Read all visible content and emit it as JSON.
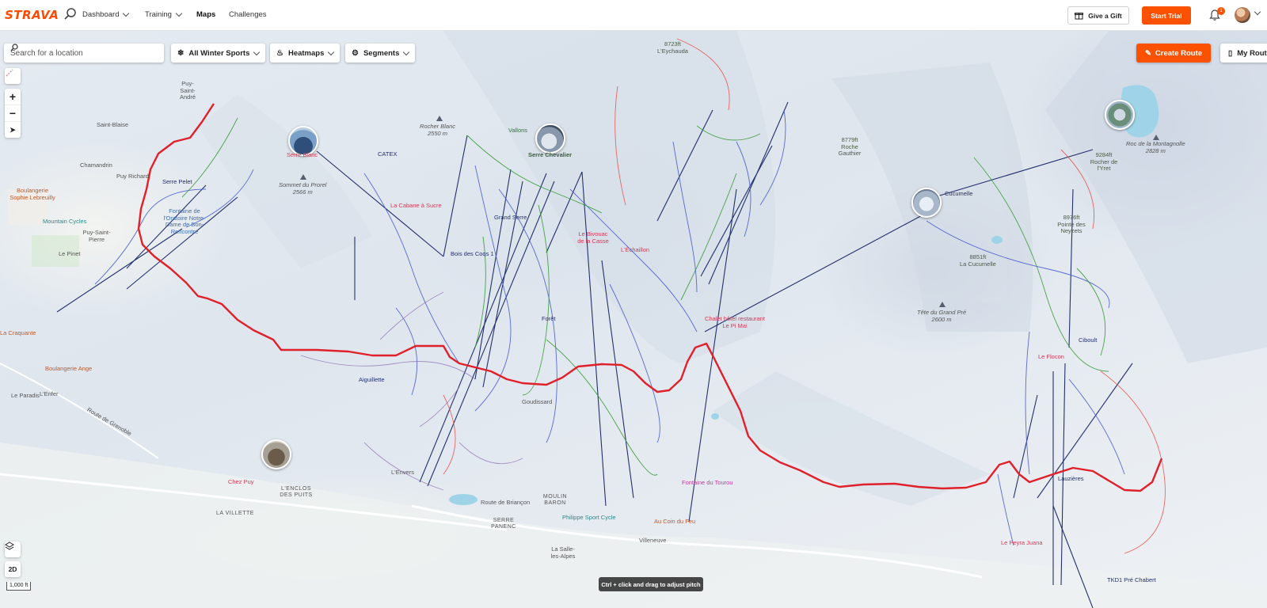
{
  "header": {
    "logo": "STRAVA",
    "nav": [
      {
        "label": "Dashboard",
        "has_chevron": true
      },
      {
        "label": "Training",
        "has_chevron": true
      },
      {
        "label": "Maps",
        "active": true
      },
      {
        "label": "Challenges"
      }
    ],
    "gift_label": "Give a Gift",
    "trial_label": "Start Trial",
    "notification_count": "1"
  },
  "map_controls": {
    "search_placeholder": "Search for a location",
    "sport_filter": "All Winter Sports",
    "heatmaps": "Heatmaps",
    "segments": "Segments",
    "create_route": "Create Route",
    "my_routes": "My Routes",
    "zoom_in": "+",
    "zoom_out": "−",
    "mode_2d": "2D",
    "scale": "1,000 ft",
    "pitch_hint": "Ctrl + click and drag to adjust pitch"
  },
  "map_labels": {
    "peaks": [
      {
        "elev": "8723ft",
        "name": "L'Eychauda"
      },
      {
        "elev": "8779ft",
        "name": "Roche Gauthier"
      },
      {
        "elev": "9284ft",
        "name": "Rocher de l'Yret"
      },
      {
        "elev": "8976ft",
        "name": "Pointe des Neyzets"
      },
      {
        "elev": "8851ft",
        "name": "La Cucumelle"
      }
    ],
    "summits": [
      {
        "name": "Rocher Blanc",
        "elev": "2550 m"
      },
      {
        "name": "Sommet du Prorel",
        "elev": "2566 m"
      },
      {
        "name": "Roc de la Montagnolle",
        "elev": "2828 m"
      },
      {
        "name": "Tête du Grand Pré",
        "elev": "2600 m"
      }
    ],
    "restaurants": [
      "Serre Blanc",
      "La Cabane à Sucre",
      "Serre Chevalier",
      "Le Bivouac de la Casse",
      "L'Échaillon",
      "Chalet hôtel restaurant Le Pi Mai",
      "Le Flocon",
      "Le Peyra Juana",
      "Fontaine du Tourou",
      "Chez Puy"
    ],
    "lifts": [
      "Grand Serre",
      "Bois des Coqs 1",
      "Forêt",
      "Aiguillette",
      "Cucumelle",
      "Ciboult",
      "Lauzières",
      "TKD1 Pré Chabert",
      "CATEX"
    ],
    "places": [
      "Puy-Saint-André",
      "Saint-Blaise",
      "Chamandrin",
      "Puy Richard",
      "Puy-Saint-Pierre",
      "Le Pinet",
      "Boulangerie Sophie Lebreuilly",
      "Mountain Cycles",
      "Boulangerie Ange",
      "La Craquante",
      "Le Paradis",
      "L'Enfer",
      "Fontaine de l'Oratoire Notre-Dame de Bon-Rencontre",
      "Goudissard",
      "L'ENCLOS DES PUITS",
      "LA VILLETTE",
      "L'Envers",
      "MOULIN BARON",
      "SERRE PANENC",
      "Philippe Sport Cycle",
      "Au Coin du Feu",
      "Villeneuve",
      "La Salle-les-Alpes",
      "Route de Briançon",
      "Route de Grenoble",
      "Serre Pelet",
      "Vallons"
    ]
  },
  "colors": {
    "brand": "#fc4c02",
    "accent_button": "#fc5200",
    "route": "#e0202a",
    "lift": "#23306b",
    "piste_blue": "#4a5cd0",
    "piste_green": "#3a9a3a",
    "piste_red": "#e8504a"
  }
}
